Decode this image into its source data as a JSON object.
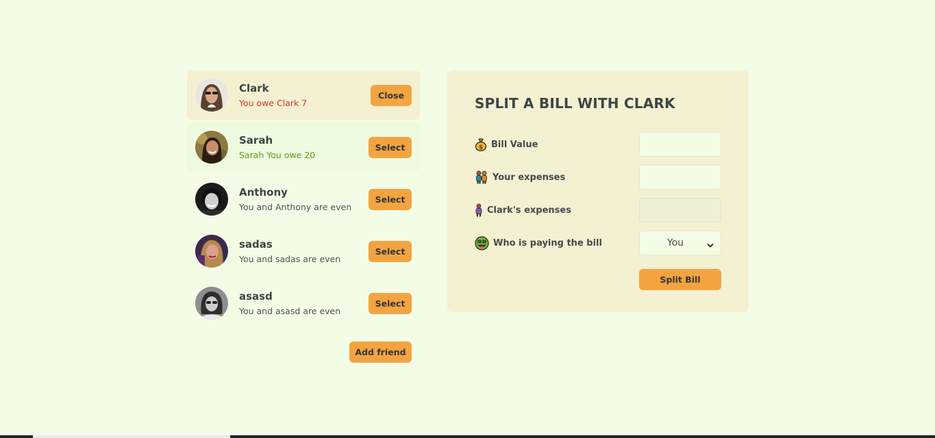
{
  "friends": [
    {
      "name": "Clark",
      "status": "You owe Clark 7",
      "status_tone": "red",
      "button": "Close",
      "selected": true,
      "avatar": "avatar-clark"
    },
    {
      "name": "Sarah",
      "status": "Sarah You owe 20",
      "status_tone": "green",
      "button": "Select",
      "selected": false,
      "avatar": "avatar-sarah"
    },
    {
      "name": "Anthony",
      "status": "You and Anthony are even",
      "status_tone": "neutral",
      "button": "Select",
      "selected": false,
      "avatar": "avatar-anthony"
    },
    {
      "name": "sadas",
      "status": "You and sadas are even",
      "status_tone": "neutral",
      "button": "Select",
      "selected": false,
      "avatar": "avatar-sadas"
    },
    {
      "name": "asasd",
      "status": "You and asasd are even",
      "status_tone": "neutral",
      "button": "Select",
      "selected": false,
      "avatar": "avatar-asasd"
    }
  ],
  "add_friend_label": "Add friend",
  "split": {
    "title": "SPLIT A BILL WITH CLARK",
    "bill_value_label": "Bill Value",
    "bill_value_icon": "money-bag-icon",
    "bill_value": "",
    "your_expenses_label": "Your expenses",
    "your_expenses_icon": "people-icon",
    "your_expenses": "",
    "friend_expenses_label": "Clark's expenses",
    "friend_expenses_icon": "person-icon",
    "friend_expenses": "",
    "payer_label": "Who is paying the bill",
    "payer_icon": "money-face-icon",
    "payer_value": "You",
    "submit_label": "Split Bill"
  },
  "colors": {
    "background": "#f3fde6",
    "panel": "#f4f0d2",
    "accent": "#f3a441",
    "owe_red": "#d9362e",
    "owed_green": "#5a9b1b"
  }
}
